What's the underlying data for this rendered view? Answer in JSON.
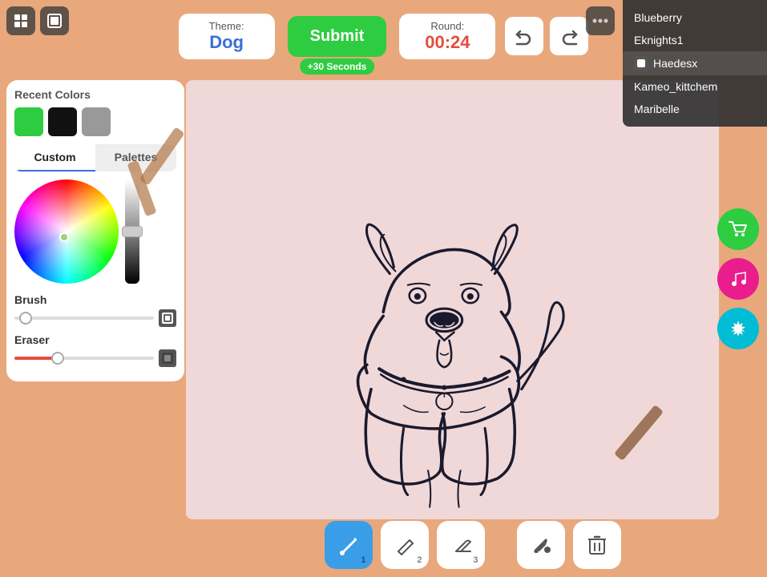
{
  "header": {
    "theme_label": "Theme:",
    "theme_value": "Dog",
    "submit_label": "Submit",
    "plus_seconds": "+30 Seconds",
    "round_label": "Round:",
    "round_value": "00:24",
    "undo_symbol": "↩",
    "redo_symbol": "↪"
  },
  "left_panel": {
    "recent_colors_label": "Recent Colors",
    "swatches": [
      {
        "color": "#2ecc40",
        "name": "green"
      },
      {
        "color": "#111111",
        "name": "black"
      },
      {
        "color": "#999999",
        "name": "gray"
      }
    ],
    "tab_custom": "Custom",
    "tab_palettes": "Palettes",
    "brush_label": "Brush",
    "eraser_label": "Eraser"
  },
  "bottom_toolbar": {
    "brush_icon": "✏",
    "brush_num": "1",
    "pencil_icon": "/",
    "pencil_num": "2",
    "eraser_icon": "◇",
    "eraser_num": "3",
    "fill_icon": "🪣",
    "trash_icon": "🗑"
  },
  "right_buttons": [
    {
      "icon": "🛒",
      "color": "#2ecc40",
      "name": "shop"
    },
    {
      "icon": "🎵",
      "color": "#e91e8c",
      "name": "music"
    },
    {
      "icon": "⚙",
      "color": "#00bcd4",
      "name": "settings"
    }
  ],
  "players": [
    {
      "name": "Blueberry",
      "active": false,
      "has_icon": false
    },
    {
      "name": "Eknights1",
      "active": false,
      "has_icon": false
    },
    {
      "name": "Haedesx",
      "active": true,
      "has_icon": true
    },
    {
      "name": "Kameo_kittchem",
      "active": false,
      "has_icon": false
    },
    {
      "name": "Maribelle",
      "active": false,
      "has_icon": false
    }
  ],
  "top_left": {
    "icon1": "⬛",
    "icon2": "⬛"
  },
  "top_right": {
    "icon": "•••"
  }
}
